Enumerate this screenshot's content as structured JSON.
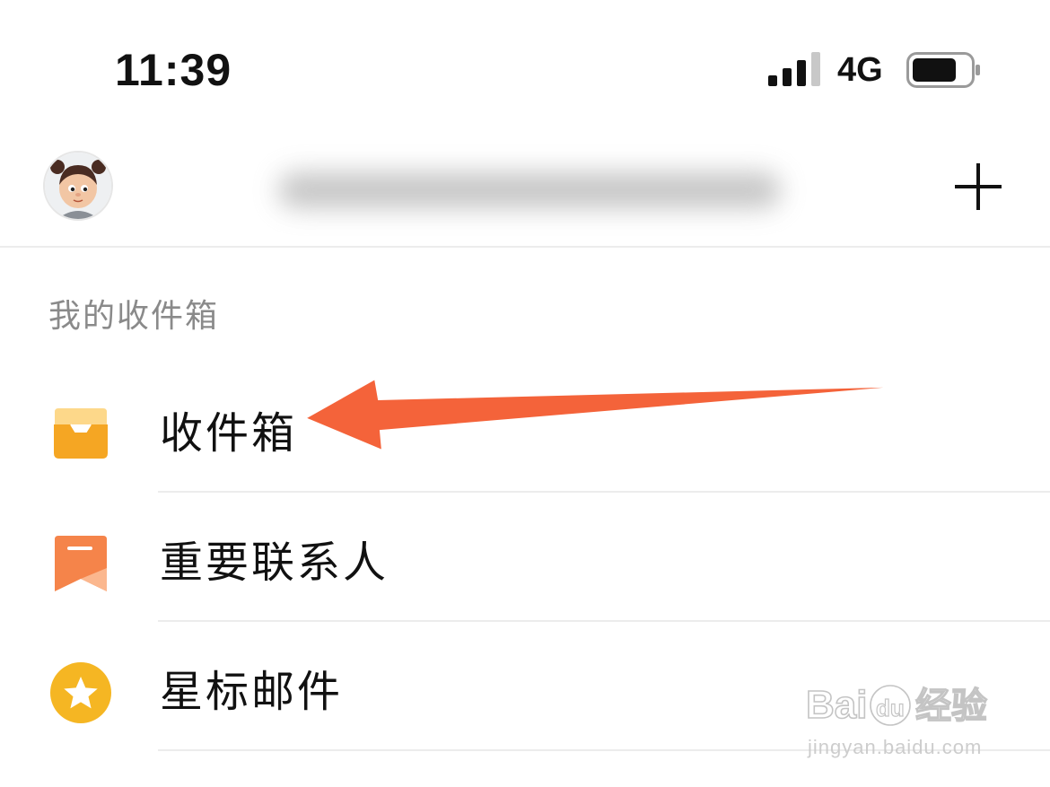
{
  "status_bar": {
    "time": "11:39",
    "network": "4G",
    "signal_bars_active": 3,
    "signal_bars_total": 4
  },
  "header": {
    "account_name": "",
    "add_icon": "plus-icon"
  },
  "section": {
    "title": "我的收件箱"
  },
  "menu": {
    "items": [
      {
        "label": "收件箱",
        "icon": "inbox-tray-icon",
        "color": "#F5A623"
      },
      {
        "label": "重要联系人",
        "icon": "bookmark-icon",
        "color": "#F5844A"
      },
      {
        "label": "星标邮件",
        "icon": "star-icon",
        "color": "#F5B623"
      }
    ]
  },
  "annotation": {
    "arrow_color": "#F4633A"
  },
  "watermark": {
    "text": "Baidu经验",
    "url": "jingyan.baidu.com"
  }
}
